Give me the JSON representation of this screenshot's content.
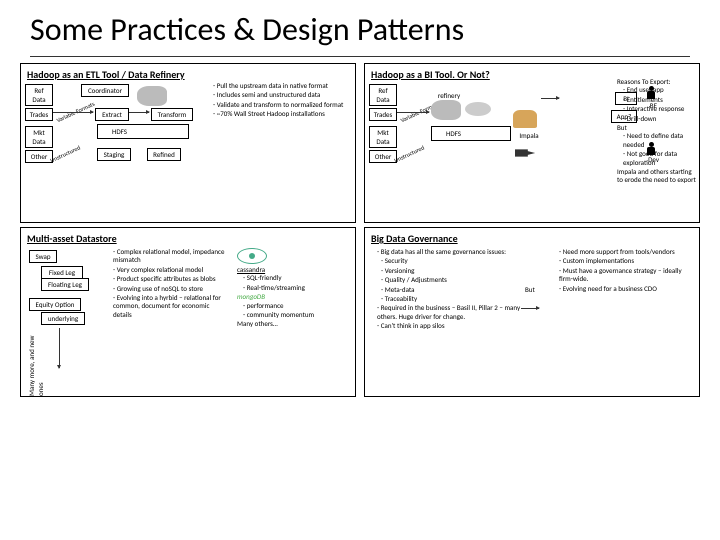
{
  "title": "Some Practices & Design Patterns",
  "q1": {
    "title": "Hadoop as an ETL Tool / Data Refinery",
    "boxes": {
      "ref_data": "Ref Data",
      "trades": "Trades",
      "mkt_data": "Mkt Data",
      "other": "Other",
      "coordinator": "Coordinator",
      "extract": "Extract",
      "hdfs": "HDFS",
      "staging": "Staging",
      "transform": "Transform",
      "refined": "Refined"
    },
    "labels": {
      "variable_formats": "Variable Formats",
      "unstructured": "Unstructured"
    },
    "bullets": [
      "Pull    the upstream data in native format",
      "Includes semi and unstructured data",
      "Validate and transform to normalized format",
      "~70% Wall Street Hadoop installations"
    ]
  },
  "q2": {
    "title": "Hadoop as a BI Tool. Or Not?",
    "boxes": {
      "ref_data": "Ref Data",
      "trades": "Trades",
      "mkt_data": "Mkt Data",
      "other": "Other",
      "refinery": "refinery",
      "hdfs": "HDFS",
      "bi": "BI",
      "app": "App?",
      "impala": "Impala"
    },
    "labels": {
      "variable_formats": "Variable Formats",
      "unstructured": "Unstructured",
      "be": "BE",
      "dev": "Dev"
    },
    "side": {
      "heading": "Reasons To Export:",
      "items": [
        "End user app",
        "Entitlements",
        "Interactive response",
        "Drill-down"
      ],
      "but": "But",
      "but_items": [
        "Need to define data needed",
        "Not good for data exploration"
      ],
      "tail": "Impala and others starting to erode the need to export"
    }
  },
  "q3": {
    "title": "Multi-asset Datastore",
    "boxes": {
      "swap": "Swap",
      "fixed_leg": "Fixed Leg",
      "floating_leg": "Floating Leg",
      "equity_option": "Equity Option",
      "underlying": "underlying"
    },
    "side_label": "Many more, and new ones",
    "mid_bullets": [
      "Complex relational model, impedance mismatch",
      "Very complex relational model",
      "Product specific attributes as blobs",
      "Growing use of noSQL to store",
      "Evolving into a hyrbid – relational for common, document for economic details"
    ],
    "cassandra": "cassandra",
    "cass_bullets": [
      "SQL-friendly",
      "Real-time/streaming"
    ],
    "mongo": "mongoDB",
    "mongo_bullets": [
      "performance",
      "community momentum"
    ],
    "tail": "Many others…"
  },
  "q4": {
    "title": "Big Data Governance",
    "left": {
      "lead": "Big data has all the same governance issues:",
      "sub": [
        "Security",
        "Versioning",
        "Quality / Adjustments",
        "Meta-data",
        "Traceability"
      ],
      "items": [
        "Required in the business – Basil II, Pillar 2 – many others. Huge driver for change.",
        "Can't think in app silos"
      ]
    },
    "but": "But",
    "right": [
      "Need more support from tools/vendors",
      "Custom implementations",
      "Must have a governance strategy – ideally firm-wide.",
      "Evolving need for a business CDO"
    ]
  }
}
